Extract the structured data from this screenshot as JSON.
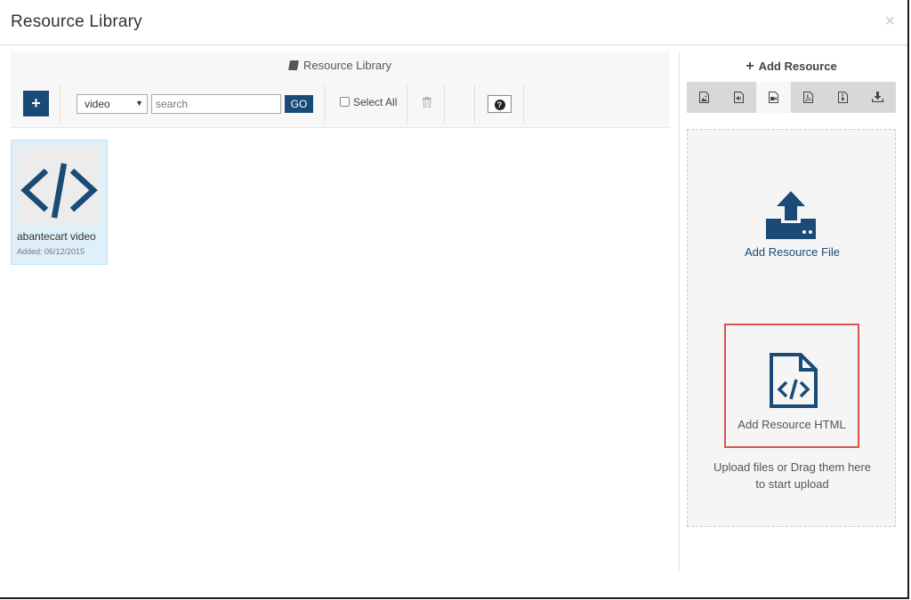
{
  "modal": {
    "title": "Resource Library",
    "close_glyph": "×"
  },
  "library": {
    "title": "Resource Library",
    "add_glyph": "+",
    "type_select": {
      "value": "video"
    },
    "search": {
      "placeholder": "search",
      "value": ""
    },
    "go_label": "GO",
    "select_all_label": "Select All",
    "help_glyph": "?"
  },
  "resources": [
    {
      "name": "abantecart video",
      "added": "Added: 06/12/2015",
      "icon": "code-icon"
    }
  ],
  "add_resource": {
    "title": "Add Resource",
    "tabs": [
      {
        "icon": "image-icon",
        "active": false
      },
      {
        "icon": "audio-icon",
        "active": false
      },
      {
        "icon": "video-icon",
        "active": true
      },
      {
        "icon": "pdf-icon",
        "active": false
      },
      {
        "icon": "archive-icon",
        "active": false
      },
      {
        "icon": "download-icon",
        "active": false
      }
    ],
    "add_file_label": "Add Resource File",
    "add_html_label": "Add Resource HTML",
    "upload_hint_line1": "Upload files or Drag them here",
    "upload_hint_line2": "to start upload"
  },
  "colors": {
    "accent": "#1a4a76",
    "highlight_border": "#d9534f",
    "card_bg": "#dff0fa"
  }
}
